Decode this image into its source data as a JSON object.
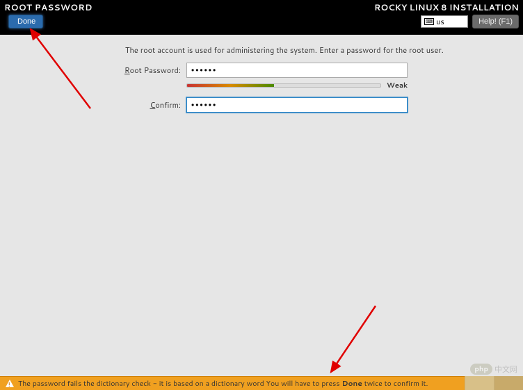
{
  "header": {
    "title": "ROOT PASSWORD",
    "done_label": "Done",
    "install_title": "ROCKY LINUX 8 INSTALLATION",
    "keyboard_layout": "us",
    "help_label": "Help! (F1)"
  },
  "form": {
    "intro": "The root account is used for administering the system.  Enter a password for the root user.",
    "root_password_label_pre": "R",
    "root_password_label_post": "oot Password:",
    "root_password_value": "••••••",
    "confirm_label_pre": "C",
    "confirm_label_post": "onfirm:",
    "confirm_value": "••••••",
    "strength_label": "Weak",
    "strength_percent": 45
  },
  "warning": {
    "text_pre": "The password fails the dictionary check - it is based on a dictionary word You will have to press ",
    "text_bold": "Done",
    "text_post": " twice to confirm it."
  },
  "watermark": {
    "logo": "php",
    "text": "中文网"
  },
  "colors": {
    "accent": "#2b6bad",
    "warning_bar": "#f0a020",
    "header_bg": "#000000"
  }
}
